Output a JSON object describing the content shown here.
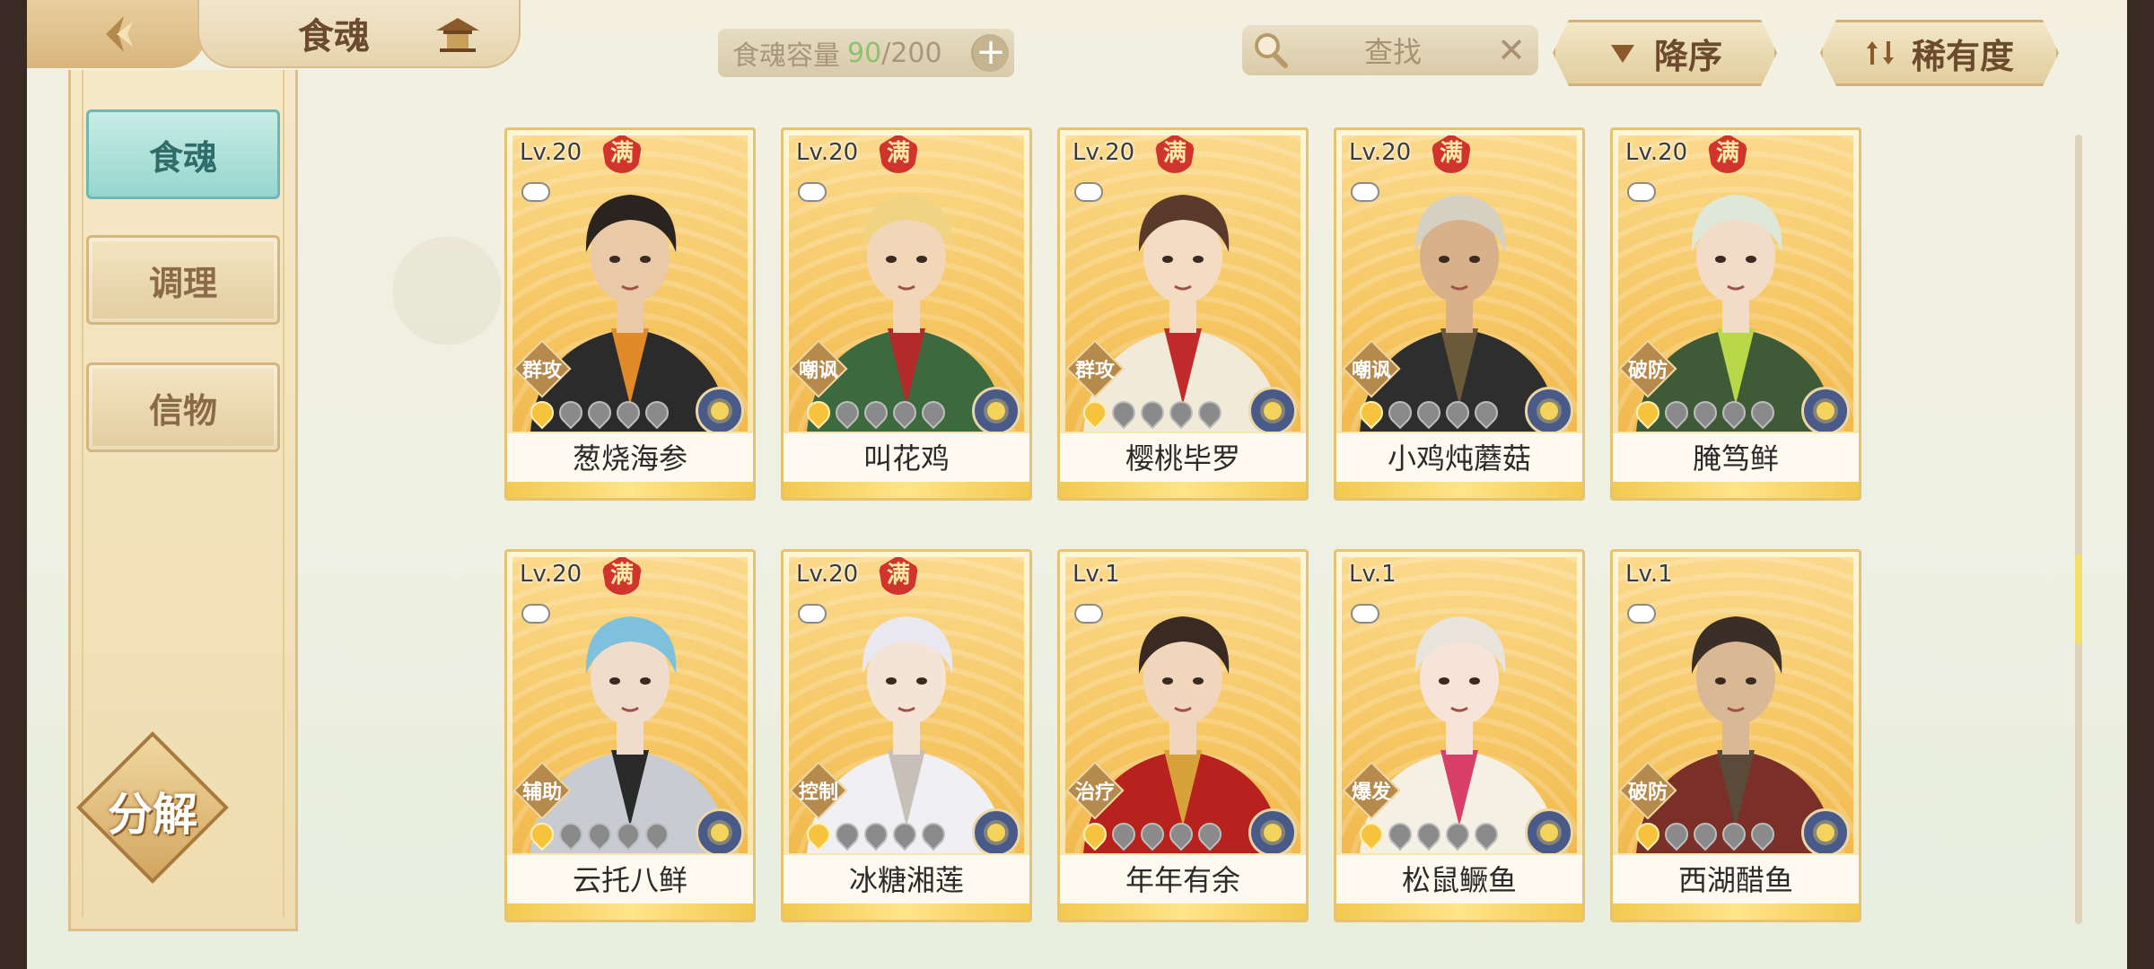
{
  "header": {
    "title": "食魂",
    "capacity_label": "食魂容量",
    "capacity_current": "90",
    "capacity_max": "/200",
    "capacity_plus": "+",
    "search_placeholder": "查找",
    "search_clear": "✕",
    "sort_order_label": "降序",
    "sort_by_label": "稀有度"
  },
  "sidebar": {
    "items": [
      {
        "label": "食魂",
        "active": true
      },
      {
        "label": "调理",
        "active": false
      },
      {
        "label": "信物",
        "active": false
      }
    ],
    "decompose_label": "分解"
  },
  "cards": [
    {
      "level": "Lv.20",
      "full": "满",
      "role": "群攻",
      "name": "葱烧海参",
      "stars": 1,
      "skin": "#e9c9a8",
      "hair": "#2a2320",
      "outfit": "#2b2b2b",
      "accent": "#e08a2a"
    },
    {
      "level": "Lv.20",
      "full": "满",
      "role": "嘲讽",
      "name": "叫花鸡",
      "stars": 1,
      "skin": "#f1d6b8",
      "hair": "#f0d483",
      "outfit": "#3c6a3e",
      "accent": "#b22a2a"
    },
    {
      "level": "Lv.20",
      "full": "满",
      "role": "群攻",
      "name": "樱桃毕罗",
      "stars": 1,
      "skin": "#f4dcc4",
      "hair": "#5a3a2a",
      "outfit": "#f2ead8",
      "accent": "#c02a2a"
    },
    {
      "level": "Lv.20",
      "full": "满",
      "role": "嘲讽",
      "name": "小鸡炖蘑菇",
      "stars": 1,
      "skin": "#d8b08a",
      "hair": "#d6d0c2",
      "outfit": "#2e2e2e",
      "accent": "#6b5a3a"
    },
    {
      "level": "Lv.20",
      "full": "满",
      "role": "破防",
      "name": "腌笃鲜",
      "stars": 1,
      "skin": "#f2dcc8",
      "hair": "#dfe8d8",
      "outfit": "#3e5a36",
      "accent": "#b8d84a"
    },
    {
      "level": "Lv.20",
      "full": "满",
      "role": "辅助",
      "name": "云托八鲜",
      "stars": 1,
      "skin": "#f0dccb",
      "hair": "#7fc0dc",
      "outfit": "#c8ccd2",
      "accent": "#2a2a2a"
    },
    {
      "level": "Lv.20",
      "full": "满",
      "role": "控制",
      "name": "冰糖湘莲",
      "stars": 1,
      "skin": "#f4e4d6",
      "hair": "#e8e8ee",
      "outfit": "#f0f0f4",
      "accent": "#c8c0b8"
    },
    {
      "level": "Lv.1",
      "full": "",
      "role": "治疗",
      "name": "年年有余",
      "stars": 1,
      "skin": "#f0d6bc",
      "hair": "#3a2a22",
      "outfit": "#b8221e",
      "accent": "#d8a23a"
    },
    {
      "level": "Lv.1",
      "full": "",
      "role": "爆发",
      "name": "松鼠鳜鱼",
      "stars": 1,
      "skin": "#f6e4d8",
      "hair": "#e8e4dc",
      "outfit": "#f4f0e4",
      "accent": "#d8406a"
    },
    {
      "level": "Lv.1",
      "full": "",
      "role": "破防",
      "name": "西湖醋鱼",
      "stars": 1,
      "skin": "#d9b896",
      "hair": "#3a2e26",
      "outfit": "#7a3028",
      "accent": "#5a4a3a"
    }
  ],
  "scroll_position": 0.6
}
